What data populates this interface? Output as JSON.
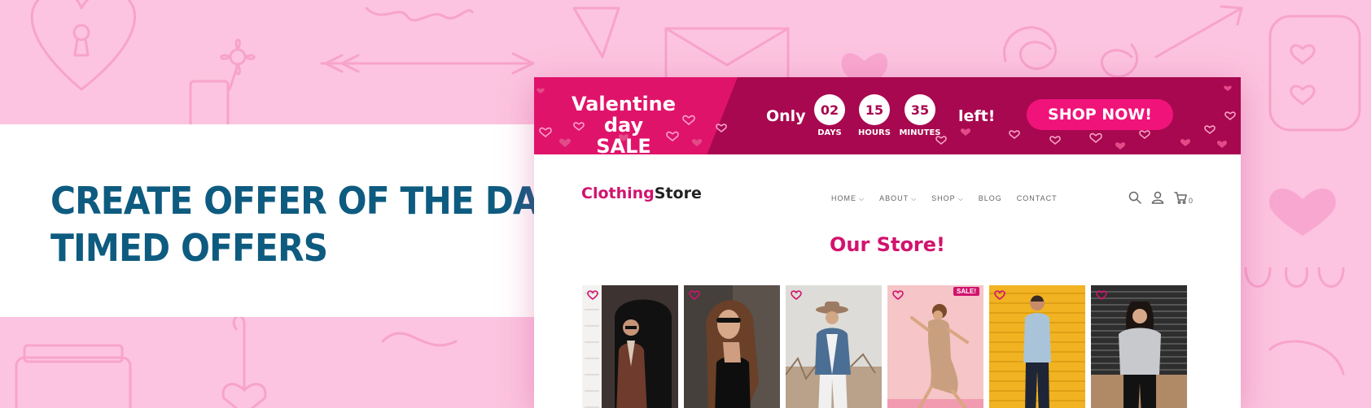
{
  "headline": {
    "line1": "CREATE OFFER OF THE DAY",
    "line2": "TIMED OFFERS"
  },
  "banner": {
    "title_line1": "Valentine day",
    "title_line2": "SALE",
    "only": "Only",
    "left": "left!",
    "countdown": [
      {
        "value": "02",
        "unit": "DAYS"
      },
      {
        "value": "15",
        "unit": "HOURS"
      },
      {
        "value": "35",
        "unit": "MINUTES"
      }
    ],
    "cta": "SHOP NOW!"
  },
  "store": {
    "logo_part1": "Clothing",
    "logo_part2": "Store",
    "nav": [
      {
        "label": "HOME",
        "dropdown": true
      },
      {
        "label": "ABOUT",
        "dropdown": true
      },
      {
        "label": "SHOP",
        "dropdown": true
      },
      {
        "label": "BLOG",
        "dropdown": false
      },
      {
        "label": "CONTACT",
        "dropdown": false
      }
    ],
    "cart_count": "0",
    "title": "Our Store!",
    "sale_badge": "SALE!"
  },
  "icons": {
    "search": "search-icon",
    "user": "user-icon",
    "cart": "cart-icon",
    "wishlist": "heart-icon",
    "chevron": "chevron-down-icon"
  },
  "colors": {
    "background": "#fcc4e0",
    "headline": "#0e5b80",
    "banner_dark": "#a8084f",
    "banner_light": "#e0136b",
    "accent": "#d1136e",
    "cta": "#f0137a"
  }
}
